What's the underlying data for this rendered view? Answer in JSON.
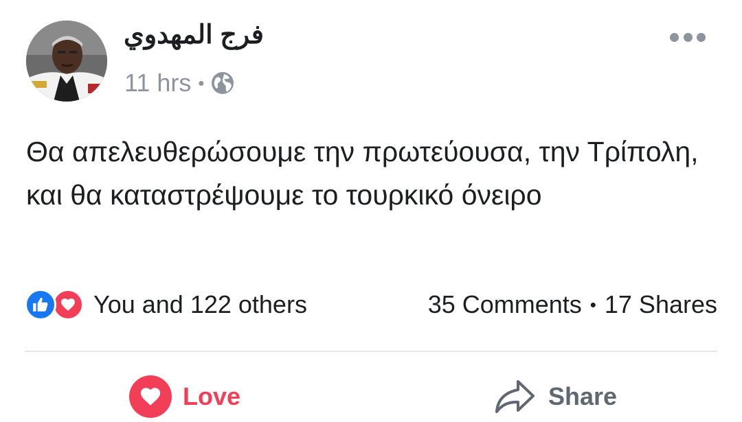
{
  "post": {
    "author": "فرج المهدوي",
    "time": "11 hrs",
    "separator": "•",
    "privacy_icon": "globe-icon",
    "menu_icon": "more-dots-icon",
    "text": "Θα απελευθερώσουμε την πρωτεύουσα, την Τρίπολη, και θα καταστρέψουμε το τουρκικό όνειρο"
  },
  "reactions": {
    "icons": [
      "like-icon",
      "love-icon"
    ],
    "summary": "You and 122 others",
    "comments": "35 Comments",
    "separator": "•",
    "shares": "17 Shares"
  },
  "actions": {
    "love_label": "Love",
    "share_label": "Share"
  },
  "colors": {
    "text": "#1c1e21",
    "meta": "#8d949e",
    "like_blue": "#1877f2",
    "love_red": "#f33e58",
    "action_gray": "#606770",
    "divider": "#e4e6eb"
  }
}
